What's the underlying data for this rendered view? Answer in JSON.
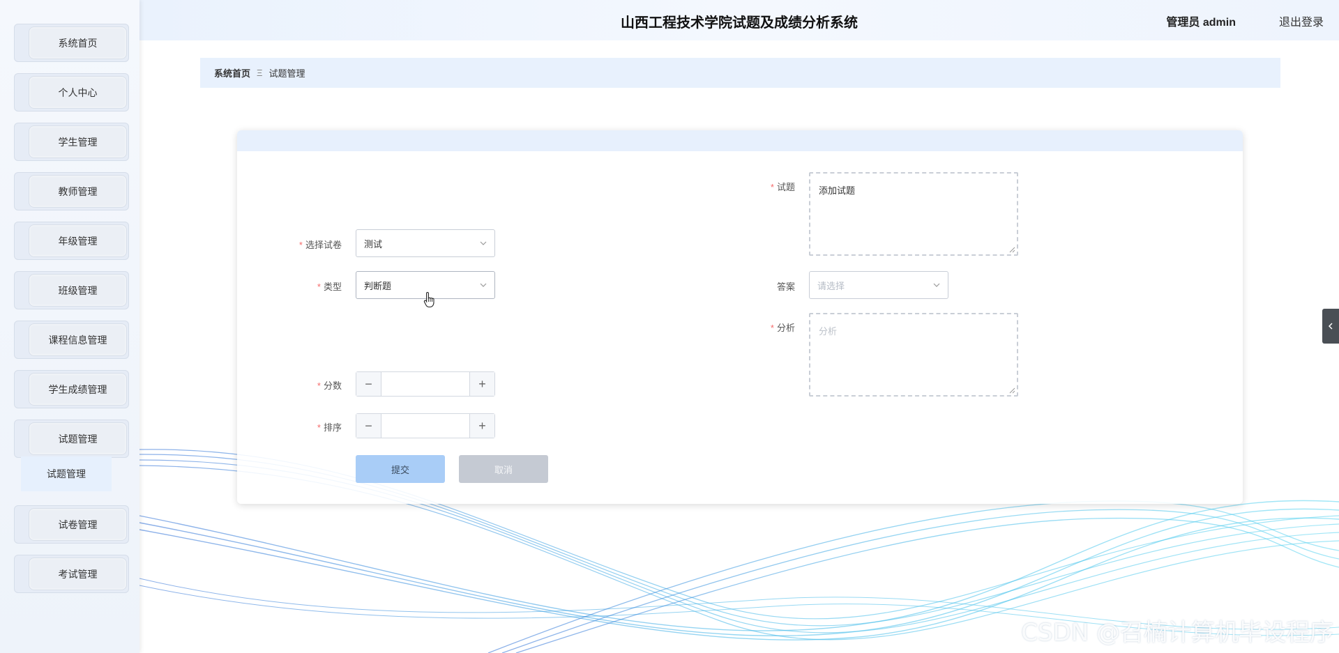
{
  "app": {
    "title": "山西工程技术学院试题及成绩分析系统",
    "user": "管理员 admin",
    "logout": "退出登录"
  },
  "sidebar": {
    "items": [
      {
        "label": "系统首页"
      },
      {
        "label": "个人中心"
      },
      {
        "label": "学生管理"
      },
      {
        "label": "教师管理"
      },
      {
        "label": "年级管理"
      },
      {
        "label": "班级管理"
      },
      {
        "label": "课程信息管理"
      },
      {
        "label": "学生成绩管理"
      },
      {
        "label": "试题管理"
      },
      {
        "label": "试卷管理"
      },
      {
        "label": "考试管理"
      }
    ],
    "submenu": {
      "label": "试题管理"
    }
  },
  "breadcrumb": {
    "home": "系统首页",
    "separator": "Ξ",
    "current": "试题管理"
  },
  "form": {
    "paper": {
      "label": "选择试卷",
      "value": "测试"
    },
    "type": {
      "label": "类型",
      "value": "判断题"
    },
    "score": {
      "label": "分数",
      "value": ""
    },
    "order": {
      "label": "排序",
      "value": ""
    },
    "question": {
      "label": "试题",
      "value": "添加试题"
    },
    "answer": {
      "label": "答案",
      "placeholder": "请选择"
    },
    "analysis": {
      "label": "分析",
      "placeholder": "分析"
    },
    "submit": "提交",
    "cancel": "取消",
    "required_mark": "*",
    "minus": "−",
    "plus": "+"
  },
  "watermark": "CSDN @召楠计算机毕设程序",
  "icons": {
    "select_arrow": "chevron-down-icon",
    "side_toggle": "chevron-left-icon",
    "cursor": "hand-pointer-icon"
  },
  "colors": {
    "primary_light": "#a9cdf7",
    "required": "#f56c6c",
    "header_bg": "#eaf2fd"
  }
}
